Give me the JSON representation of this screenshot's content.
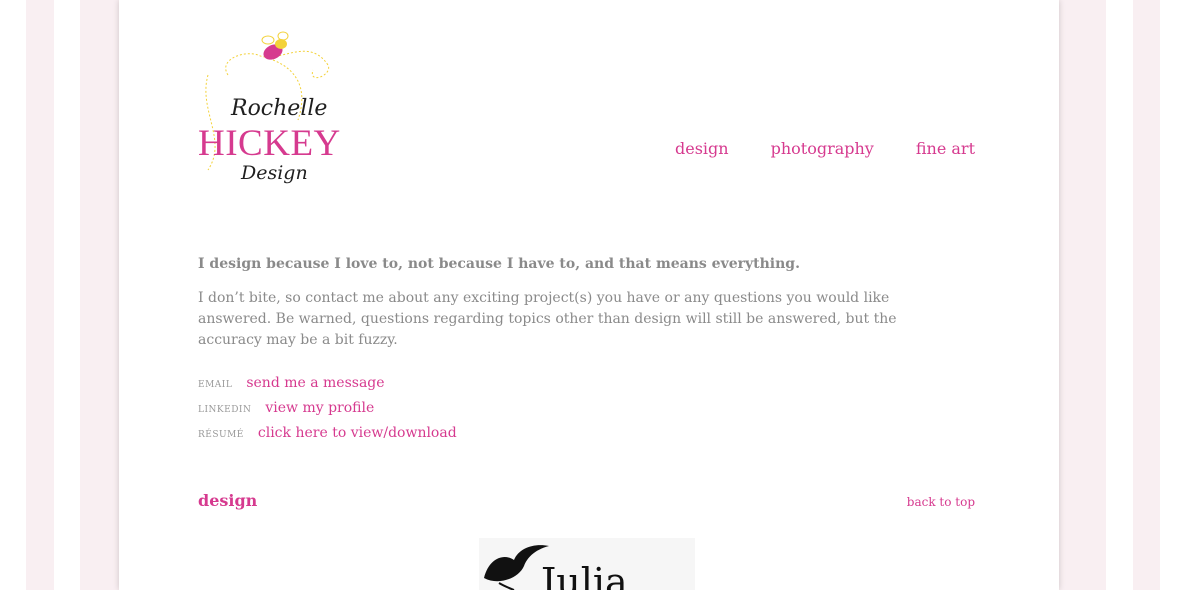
{
  "brand": {
    "line1": "Rochelle",
    "line2": "HICKEY",
    "line3": "Design"
  },
  "nav": {
    "items": [
      "design",
      "photography",
      "fine art"
    ]
  },
  "intro": {
    "lead": "I design because I love to, not because I have to, and that means everything.",
    "body": "I don’t bite, so contact me about any exciting project(s) you have or any questions you would like answered. Be warned, questions regarding topics other than design will still be answered, but the accuracy may be a bit fuzzy."
  },
  "contact": {
    "rows": [
      {
        "label": "EMAIL",
        "link": "send me a message"
      },
      {
        "label": "LINKEDIN",
        "link": "view my profile"
      },
      {
        "label": "RÉSUMÉ",
        "link": "click here to view/download"
      }
    ]
  },
  "section": {
    "title": "design",
    "back_to_top": "back to top"
  },
  "thumbnail": {
    "text": "Julia"
  },
  "colors": {
    "accent": "#d63a8f",
    "text_gray": "#8a8a8a",
    "stripe": "#f9eff2",
    "bee_yellow": "#f3d23a"
  }
}
